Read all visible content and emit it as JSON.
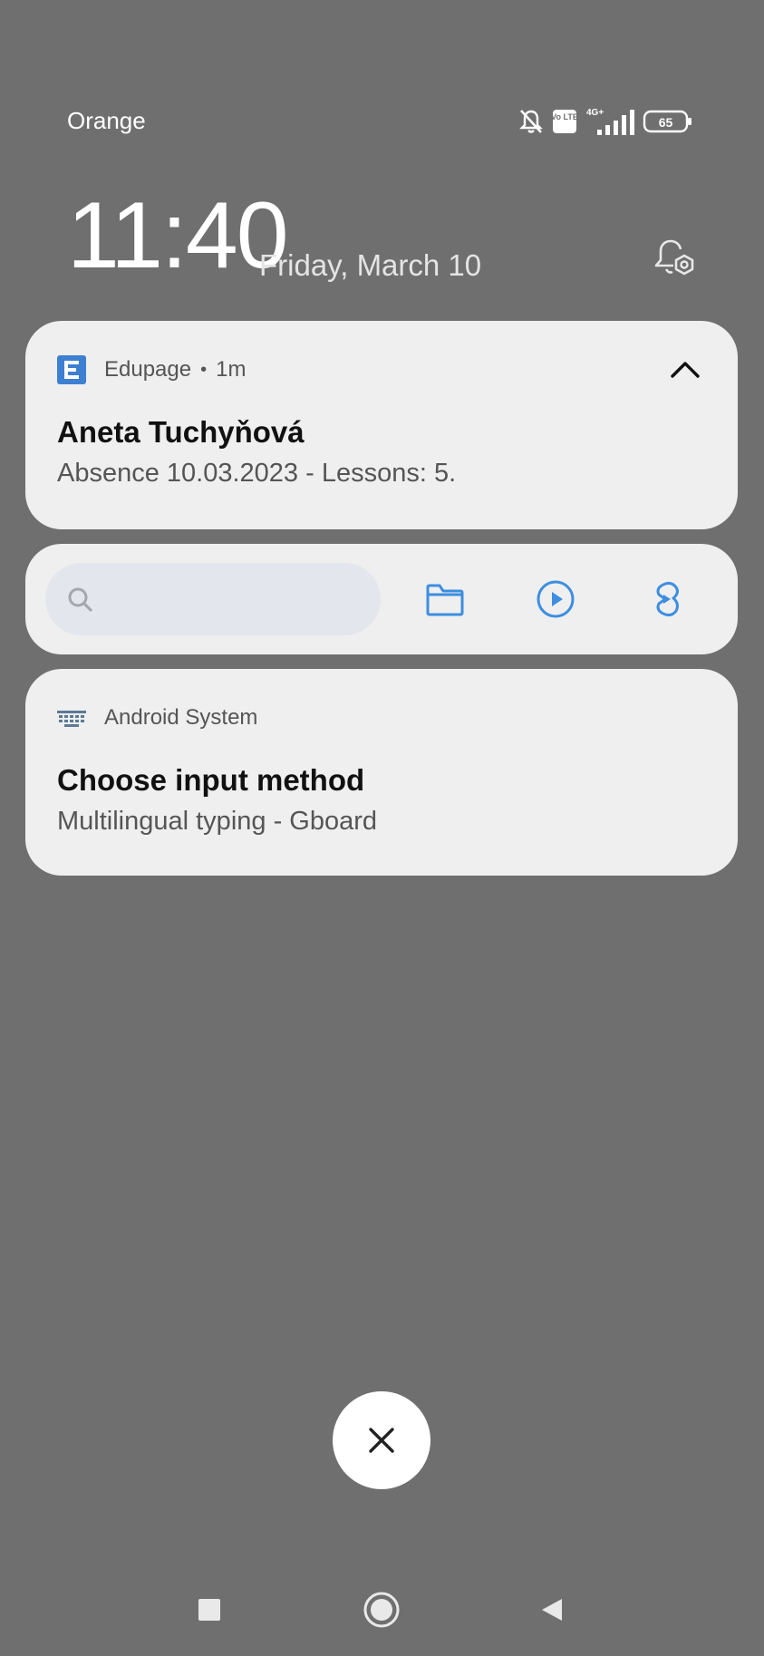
{
  "status_bar": {
    "carrier": "Orange",
    "network_type": "4G+",
    "volte_label": "Vo LTE",
    "battery": "65",
    "icons": [
      "bell-off-icon",
      "volte-icon",
      "signal-icon",
      "battery-icon"
    ]
  },
  "lockscreen": {
    "time": "11:40",
    "date": "Friday, March 10"
  },
  "notifications": [
    {
      "app": "Edupage",
      "time": "1m",
      "title": "Aneta Tuchyňová",
      "text": "Absence 10.03.2023 - Lessons: 5.",
      "icon": "edupage-icon"
    },
    {
      "app": "Android System",
      "title": "Choose input method",
      "text": "Multilingual typing - Gboard",
      "icon": "keyboard-icon"
    }
  ],
  "toolbar": {
    "search_placeholder": "",
    "buttons": [
      "files-icon",
      "video-icon",
      "shortcut-icon"
    ]
  },
  "colors": {
    "background": "#6f6f6f",
    "card": "#efefef",
    "accent_blue": "#3d8ee0",
    "search_box": "#e3e6ed"
  },
  "navigation": [
    "recents-button",
    "home-button",
    "back-button"
  ]
}
